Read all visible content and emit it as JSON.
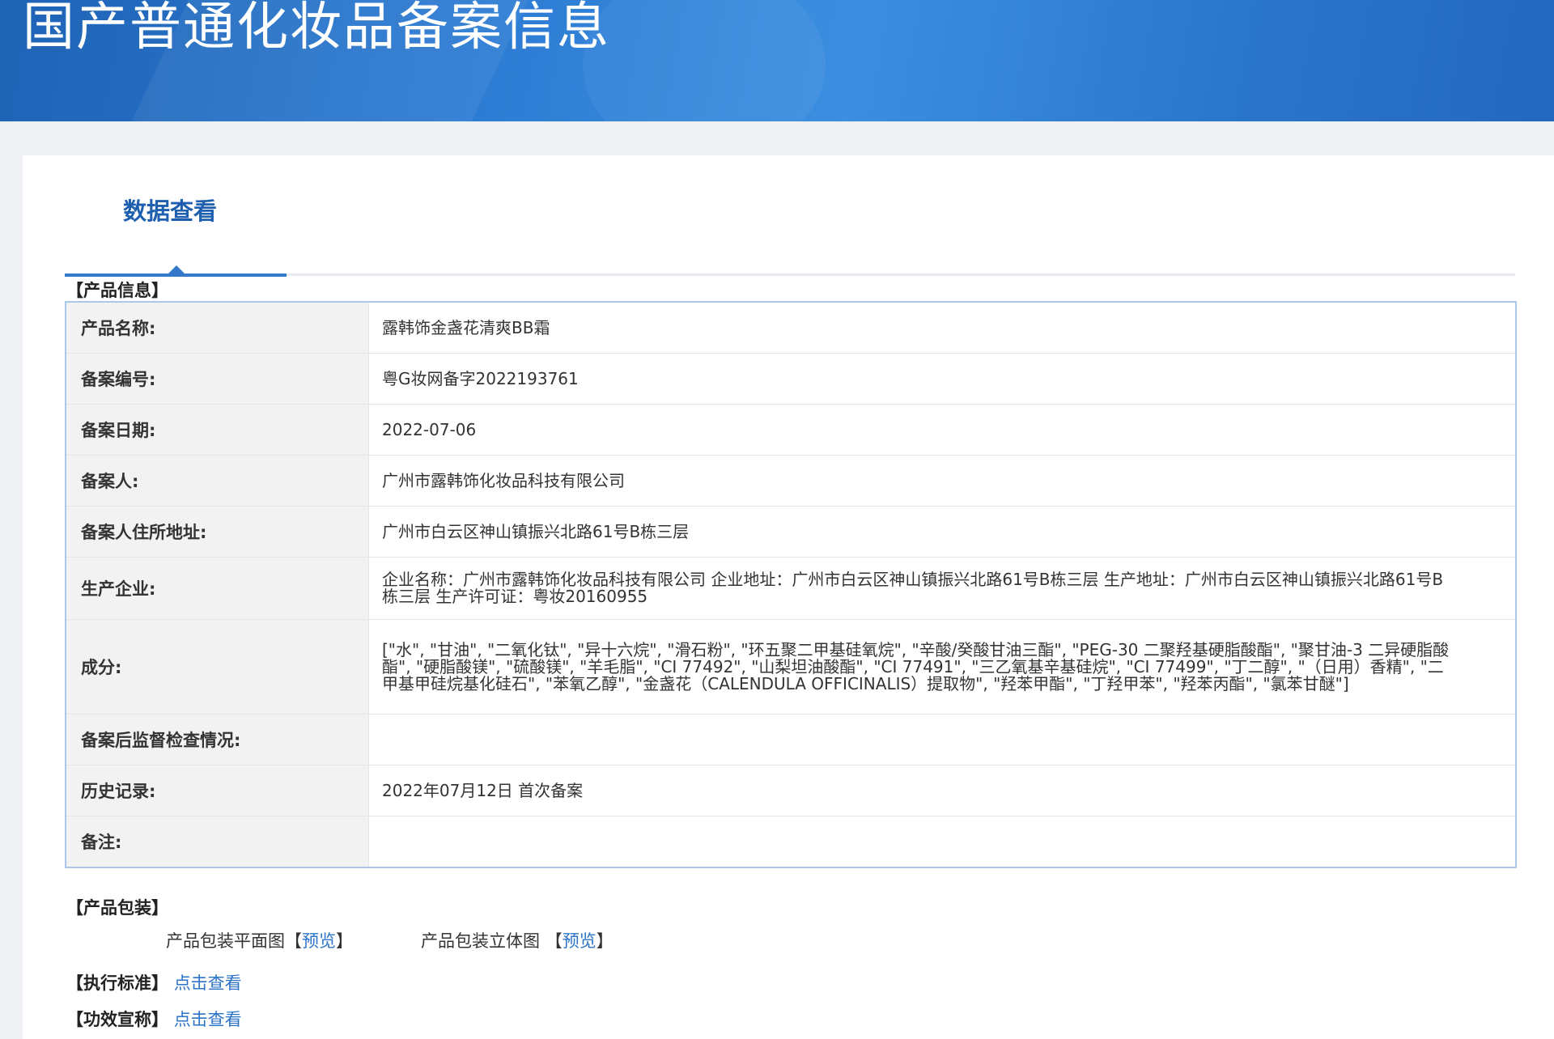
{
  "banner": {
    "title": "国产普通化妆品备案信息"
  },
  "tabs": {
    "active_label": "数据查看"
  },
  "sections": {
    "product_info": "【产品信息】",
    "packaging": "【产品包装】",
    "standard": "【执行标准】",
    "efficacy": "【功效宣称】"
  },
  "info_rows": [
    {
      "label": "产品名称:",
      "value": "露韩饰金盏花清爽BB霜"
    },
    {
      "label": "备案编号:",
      "value": "粤G妆网备字2022193761"
    },
    {
      "label": "备案日期:",
      "value": "2022-07-06"
    },
    {
      "label": "备案人:",
      "value": "广州市露韩饰化妆品科技有限公司"
    },
    {
      "label": "备案人住所地址:",
      "value": "广州市白云区神山镇振兴北路61号B栋三层"
    },
    {
      "label": "生产企业:",
      "value": "企业名称：广州市露韩饰化妆品科技有限公司 企业地址：广州市白云区神山镇振兴北路61号B栋三层 生产地址：广州市白云区神山镇振兴北路61号B栋三层 生产许可证：粤妆20160955"
    },
    {
      "label": "成分:",
      "value": "[\"水\", \"甘油\", \"二氧化钛\", \"异十六烷\", \"滑石粉\", \"环五聚二甲基硅氧烷\", \"辛酸/癸酸甘油三酯\", \"PEG-30 二聚羟基硬脂酸酯\", \"聚甘油-3 二异硬脂酸酯\", \"硬脂酸镁\", \"硫酸镁\", \"羊毛脂\", \"CI 77492\", \"山梨坦油酸酯\", \"CI 77491\", \"三乙氧基辛基硅烷\", \"CI 77499\", \"丁二醇\", \"（日用）香精\", \"二甲基甲硅烷基化硅石\", \"苯氧乙醇\", \"金盏花（CALENDULA OFFICINALIS）提取物\", \"羟苯甲酯\", \"丁羟甲苯\", \"羟苯丙酯\", \"氯苯甘醚\"]"
    },
    {
      "label": "备案后监督检查情况:",
      "value": ""
    },
    {
      "label": "历史记录:",
      "value": "2022年07月12日 首次备案"
    },
    {
      "label": "备注:",
      "value": ""
    }
  ],
  "packaging": {
    "flat_label": "产品包装平面图",
    "stereo_label": "产品包装立体图",
    "bracket_open": "【",
    "bracket_close": "】",
    "preview_link": "预览"
  },
  "links": {
    "view_label": "点击查看"
  }
}
